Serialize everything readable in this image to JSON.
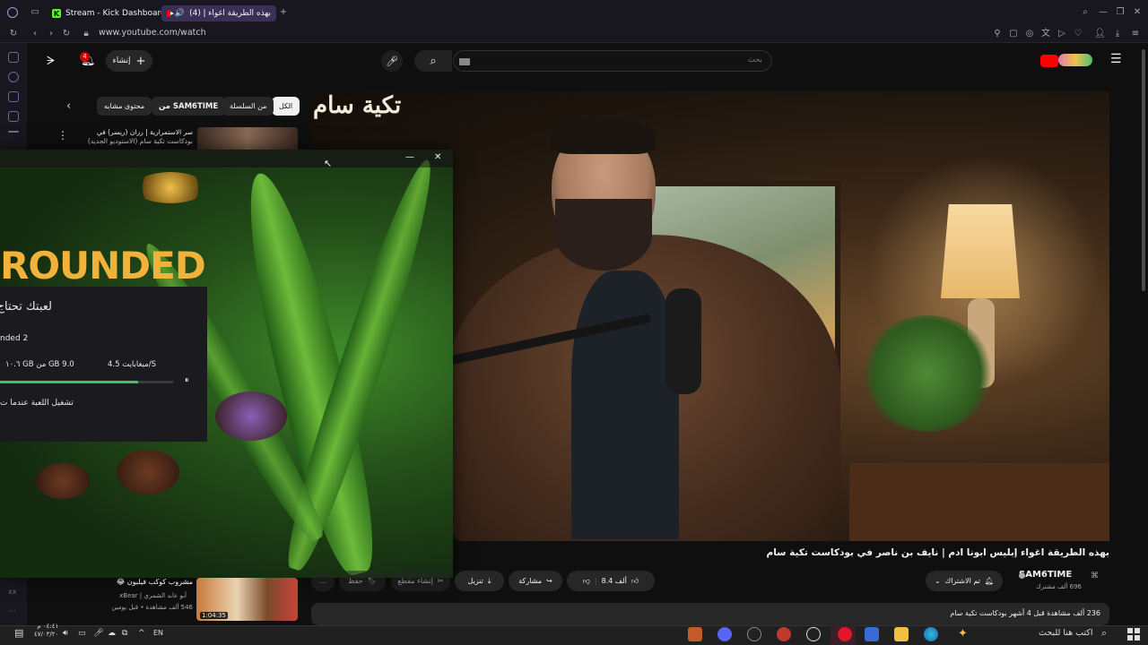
{
  "browser": {
    "tabs": [
      {
        "label": "Stream - Kick Dashboard",
        "active": false
      },
      {
        "label": "(4) بهذه الطريقة اغواء إ",
        "active": true
      }
    ],
    "new_tab_label": "+",
    "url": "www.youtube.com/watch"
  },
  "youtube": {
    "create_label": "إنشاء",
    "notifications_count": "4",
    "search_placeholder": "بحث",
    "chips": [
      "الكل",
      "من السلسلة",
      "من SAM6TIME",
      "محتوى مشابه"
    ],
    "video_title": "بهذه الطريقة اغواء إبليس ابونا ادم | نايف بن ناصر في بودكاست تكية سام",
    "video_logo_text": "تكية سام",
    "channel": {
      "name": "SAM6TIME",
      "subscribers": "696 ألف مشترك"
    },
    "subscribed_label": "تم الاشتراك",
    "likes": "8.4 ألف",
    "share_label": "مشاركة",
    "download_label": "تنزيل",
    "clip_label": "إنشاء مقطع",
    "save_label": "حفظ",
    "more_label": "...",
    "description_meta": "236 ألف مشاهدة قبل 4 أشهر بودكاست تكية سام",
    "related": [
      {
        "title_line1": "سر الاستمرارية | رزان (ريسر) في",
        "title_line2": "بودكاست تكية سام (الاستوديو الجديد)"
      },
      {
        "title_line1": "مشروب كوكب فيلبون 😂",
        "channel": "أبو عابد الشمري | xBear",
        "meta": "546 ألف مشاهدة • قبل يومين",
        "duration": "1:04:35"
      }
    ]
  },
  "launcher": {
    "game_logo": "ROUNDED",
    "heading": "لعبتك تحتاج",
    "game_name": "nded 2",
    "download_speed": "4.5 ميغابايت/S",
    "download_size": "9.0 GB من GB ١٠.٦",
    "progress": 0.8,
    "pause_icon": "⏸",
    "play_when_ready": "تشغيل اللعبة عندما ت",
    "minimize": "—",
    "close": "✕"
  },
  "taskbar": {
    "time": "٠٤:٤١ م",
    "date": "٤٧/٠٣/٢٠",
    "language": "EN",
    "search_placeholder": "اكتب هنا للبحث"
  },
  "colors": {
    "yt_bg": "#0f0f0f",
    "kick_green": "#53fc18",
    "yt_red": "#ff0000",
    "progress_green": "#3fbf6f"
  }
}
